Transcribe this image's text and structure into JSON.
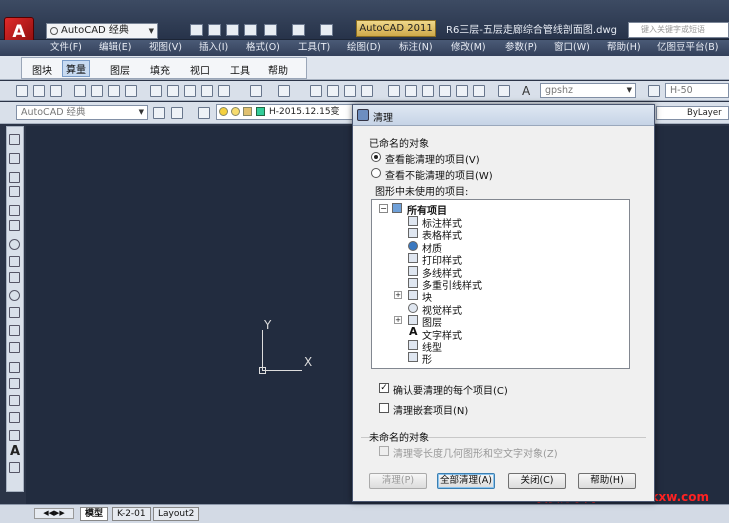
{
  "app": {
    "logo_letter": "A",
    "workspace": "AutoCAD 经典",
    "app_name": "AutoCAD 2011",
    "document_title": "R6三层-五层走廊综合管线剖面图.dwg",
    "search_placeholder": "键入关键字或短语"
  },
  "menu": [
    "文件(F)",
    "编辑(E)",
    "视图(V)",
    "插入(I)",
    "格式(O)",
    "工具(T)",
    "绘图(D)",
    "标注(N)",
    "修改(M)",
    "参数(P)",
    "窗口(W)",
    "帮助(H)",
    "亿图豆平台(B)"
  ],
  "ribbon_tabs": [
    "图块",
    "算量",
    "图层",
    "填充",
    "视口",
    "工具",
    "帮助"
  ],
  "toolbar": {
    "textstyle": "gpshz",
    "dimstyle": "H-50",
    "workspace2": "AutoCAD 经典",
    "layer": "H-2015.12.15变",
    "linetype": "ByLayer"
  },
  "ucs": {
    "x_label": "X",
    "y_label": "Y"
  },
  "layout_tabs": [
    "模型",
    "K-2-01",
    "Layout2"
  ],
  "watermark": "我要分享网www.bbkxw.com",
  "dialog": {
    "title": "清理",
    "named_objects": "已命名的对象",
    "radio_purgeable": "查看能清理的项目(V)",
    "radio_nonpurgeable": "查看不能清理的项目(W)",
    "tree_caption": "图形中未使用的项目:",
    "tree_root": "所有项目",
    "tree_items": [
      "标注样式",
      "表格样式",
      "材质",
      "打印样式",
      "多线样式",
      "多重引线样式",
      "块",
      "视觉样式",
      "图层",
      "文字样式",
      "线型",
      "形"
    ],
    "confirm_each": "确认要清理的每个项目(C)",
    "purge_nested": "清理嵌套项目(N)",
    "unnamed_objects": "未命名的对象",
    "purge_zero": "清理零长度几何图形和空文字对象(Z)",
    "btn_purge": "清理(P)",
    "btn_purge_all": "全部清理(A)",
    "btn_close": "关闭(C)",
    "btn_help": "帮助(H)"
  }
}
